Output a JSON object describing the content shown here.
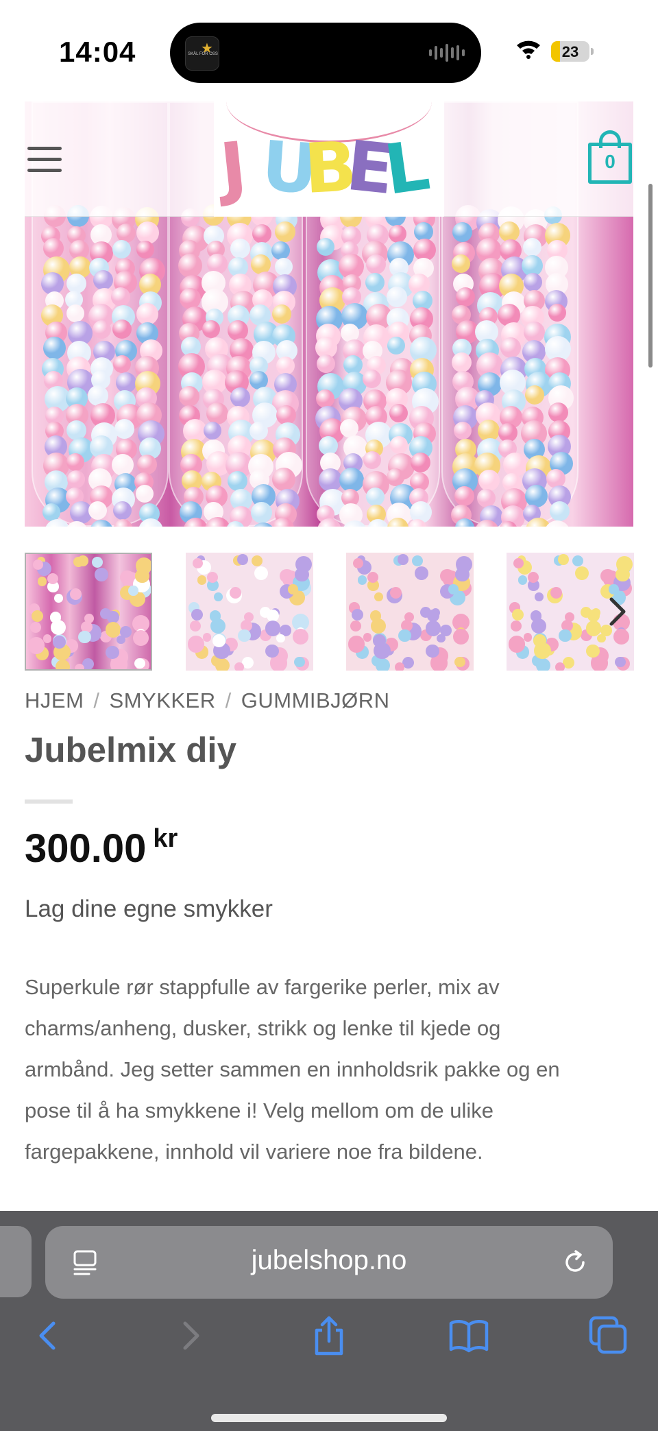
{
  "status_bar": {
    "time": "14:04",
    "battery_level": "23",
    "battery_percent": 23,
    "app_activity_label": "SKÅL FOR OSS",
    "icons": [
      "dynamic-island",
      "audio-waveform-icon",
      "wifi-icon",
      "battery-icon"
    ]
  },
  "header": {
    "cart_count": "0",
    "brand_colors": {
      "teal": "#22b5b5",
      "pink": "#e88aa8",
      "blue": "#8fd0ee",
      "yellow": "#f4e24c",
      "purple": "#8a6fc0"
    },
    "icons": [
      "menu-icon",
      "logo",
      "cart-icon"
    ]
  },
  "logo": {
    "letters": [
      {
        "char": "J",
        "color": "#e88aa8"
      },
      {
        "char": "U",
        "color": "#8fd0ee"
      },
      {
        "char": "B",
        "color": "#f4e24c"
      },
      {
        "char": "E",
        "color": "#8a6fc0"
      },
      {
        "char": "L",
        "color": "#22b5b5"
      }
    ]
  },
  "gallery": {
    "thumbnail_count": 4,
    "active_index": 0
  },
  "breadcrumb": {
    "items": [
      "HJEM",
      "SMYKKER",
      "GUMMIBJØRN"
    ],
    "separator": "/"
  },
  "product": {
    "title": "Jubelmix diy",
    "price": "300.00",
    "currency": "kr",
    "subtitle": "Lag dine egne smykker",
    "description_lines": [
      "Superkule rør stappfulle av fargerike perler, mix av",
      "charms/anheng, dusker, strikk og lenke til kjede og",
      "armbånd. Jeg setter sammen en innholdsrik pakke og en",
      "pose til å ha smykkene i! Velg mellom om de ulike",
      "fargepakkene, innhold vil variere noe fra bildene."
    ]
  },
  "browser": {
    "url": "jubelshop.no",
    "toolbar": [
      "back-icon",
      "forward-icon",
      "share-icon",
      "bookmarks-icon",
      "tabs-icon"
    ],
    "accent": "#4a8ef0"
  }
}
